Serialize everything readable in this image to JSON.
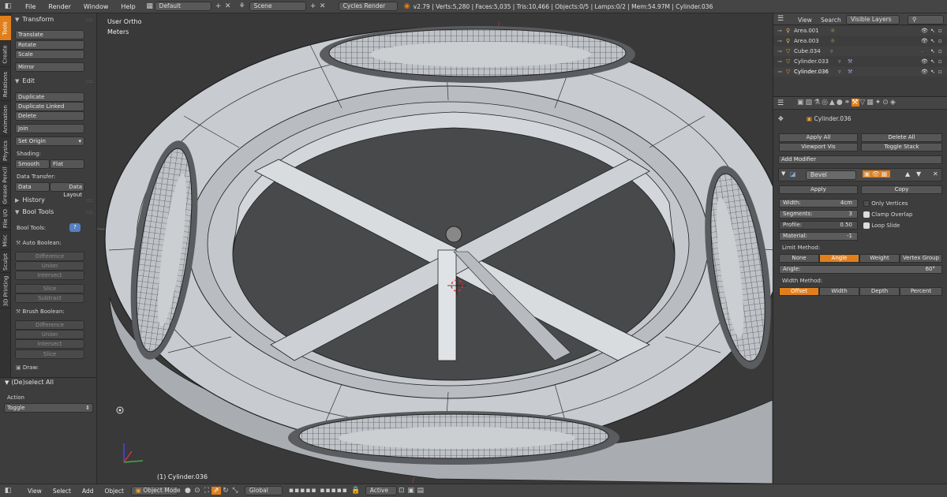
{
  "topbar": {
    "menus": [
      "File",
      "Render",
      "Window",
      "Help"
    ],
    "layout": "Default",
    "scene": "Scene",
    "engine": "Cycles Render",
    "stats": "v2.79 | Verts:5,280 | Faces:5,035 | Tris:10,466 | Objects:0/5 | Lamps:0/2 | Mem:54.97M | Cylinder.036"
  },
  "toolshelf": {
    "tabs": [
      "Tools",
      "Create",
      "Relations",
      "Animation",
      "Physics",
      "Grease Pencil",
      "File I/O",
      "Misc",
      "Sculpt",
      "3D Printing"
    ],
    "transform": {
      "title": "Transform",
      "buttons": [
        "Translate",
        "Rotate",
        "Scale",
        "Mirror"
      ]
    },
    "edit": {
      "title": "Edit",
      "duplicate": "Duplicate",
      "duplicate_linked": "Duplicate Linked",
      "delete": "Delete",
      "join": "Join",
      "set_origin": "Set Origin",
      "shading": "Shading:",
      "smooth": "Smooth",
      "flat": "Flat",
      "data_transfer": "Data Transfer:",
      "data": "Data",
      "data_layout": "Data Layout"
    },
    "history": {
      "title": "History"
    },
    "bool": {
      "title": "Bool Tools",
      "tools_label": "Bool Tools:",
      "auto_label": "Auto Boolean:",
      "auto": [
        "Difference",
        "Union",
        "Intersect",
        "Slice",
        "Subtract"
      ],
      "brush_label": "Brush Boolean:",
      "brush": [
        "Difference",
        "Union",
        "Intersect",
        "Slice"
      ],
      "draw": "Draw:"
    },
    "operator": {
      "title": "(De)select All",
      "action_label": "Action",
      "action": "Toggle"
    }
  },
  "viewport": {
    "view_name": "User Ortho",
    "units": "Meters",
    "object_label": "(1) Cylinder.036"
  },
  "outliner": {
    "view": "View",
    "search": "Search",
    "filter": "Visible Layers",
    "rows": [
      "Area.001",
      "Area.003",
      "Cube.034",
      "Cylinder.033",
      "Cylinder.036"
    ]
  },
  "properties": {
    "object": "Cylinder.036",
    "apply_all": "Apply All",
    "delete_all": "Delete All",
    "viewport_vis": "Viewport Vis",
    "toggle_stack": "Toggle Stack",
    "add_modifier": "Add Modifier",
    "modifier": {
      "name": "Bevel",
      "apply": "Apply",
      "copy": "Copy",
      "width_label": "Width:",
      "width": "4cm",
      "segments_label": "Segments:",
      "segments": "3",
      "profile_label": "Profile:",
      "profile": "0.50",
      "material_label": "Material:",
      "material": "-1",
      "only_vertices": "Only Vertices",
      "clamp_overlap": "Clamp Overlap",
      "loop_slide": "Loop Slide",
      "limit_label": "Limit Method:",
      "limit": [
        "None",
        "Angle",
        "Weight",
        "Vertex Group"
      ],
      "limit_active": "Angle",
      "angle_label": "Angle:",
      "angle": "60°",
      "width_method_label": "Width Method:",
      "width_method": [
        "Offset",
        "Width",
        "Depth",
        "Percent"
      ],
      "width_method_active": "Offset"
    }
  },
  "bottombar": {
    "menus": [
      "View",
      "Select",
      "Add",
      "Object"
    ],
    "mode": "Object Mode",
    "pivot": "Global",
    "snap": "Active"
  },
  "colors": {
    "accent": "#e07f1c",
    "selected": "#f0a030",
    "mesh": "#c8ccd0"
  }
}
